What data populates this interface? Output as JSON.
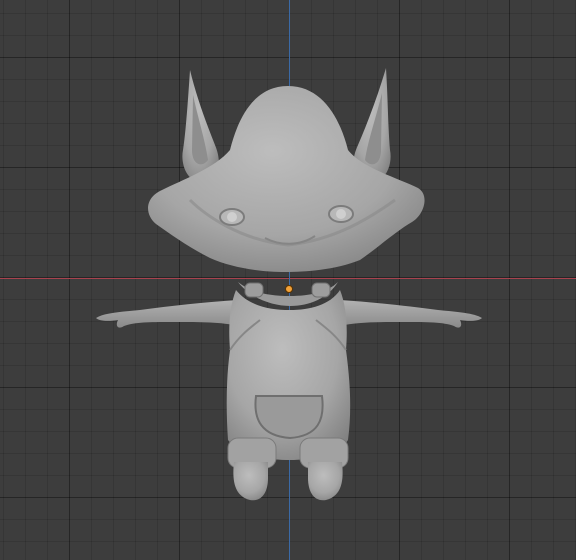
{
  "viewport": {
    "background_color": "#3d3d3d",
    "axis_x_color": "#a8434f",
    "axis_z_color": "#3b6aa6",
    "origin_color": "#f2a23a",
    "model_color": "#a9a9a9"
  },
  "icons": {
    "origin": "origin-point-icon"
  }
}
